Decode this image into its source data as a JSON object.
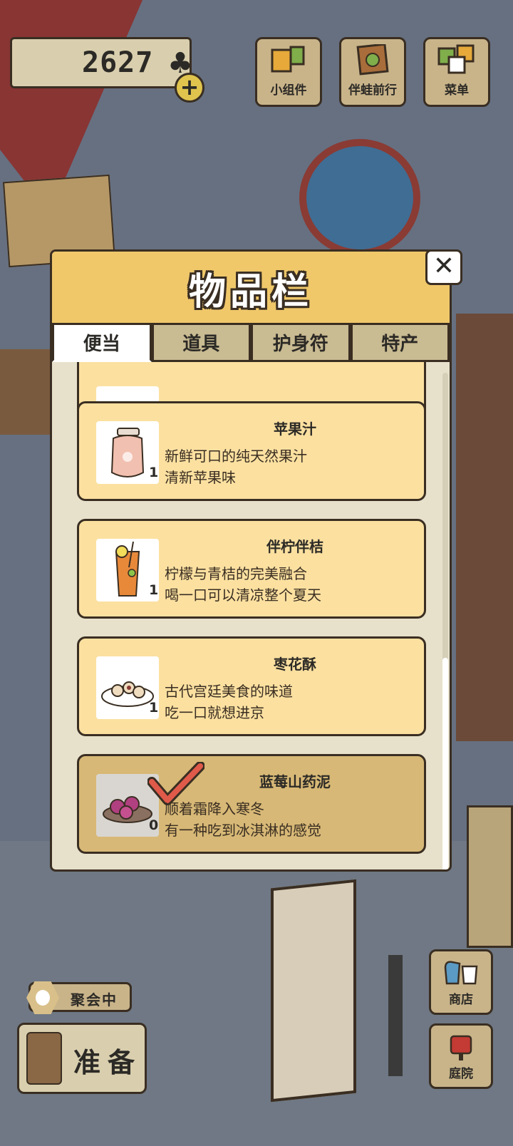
{
  "hud": {
    "clover_count": "2627",
    "clover_symbol": "♣",
    "add_symbol": "+",
    "buttons": [
      {
        "label": "小组件",
        "icon": "widget-icon"
      },
      {
        "label": "伴蛙前行",
        "icon": "frog-journey-icon"
      },
      {
        "label": "菜单",
        "icon": "menu-cards-icon"
      }
    ]
  },
  "inventory": {
    "title": "物品栏",
    "close_symbol": "✕",
    "tabs": [
      "便当",
      "道具",
      "护身符",
      "特产"
    ],
    "active_tab": "便当",
    "items": [
      {
        "name": "苹果汁",
        "desc1": "新鲜可口的纯天然果汁",
        "desc2": "清新苹果味",
        "qty": "1",
        "icon": "apple-juice-jar-icon",
        "selected": false
      },
      {
        "name": "伴柠伴桔",
        "desc1": "柠檬与青桔的完美融合",
        "desc2": "喝一口可以清凉整个夏天",
        "qty": "1",
        "icon": "lemon-drink-icon",
        "selected": false
      },
      {
        "name": "枣花酥",
        "desc1": "古代宫廷美食的味道",
        "desc2": "吃一口就想进京",
        "qty": "1",
        "icon": "date-pastry-icon",
        "selected": false
      },
      {
        "name": "蓝莓山药泥",
        "desc1": "顺着霜降入寒冬",
        "desc2": "有一种吃到冰淇淋的感觉",
        "qty": "0",
        "icon": "blueberry-yam-icon",
        "selected": true
      }
    ]
  },
  "bottom": {
    "party_label": "聚会中",
    "ready_label": "准备",
    "side_buttons": [
      {
        "label": "商店",
        "icon": "shop-bags-icon"
      },
      {
        "label": "庭院",
        "icon": "mailbox-icon"
      }
    ]
  },
  "colors": {
    "panel_header": "#f0c86a",
    "item_card": "#fbe0a0",
    "item_selected": "#d7b876",
    "check_mark": "#e05a4a",
    "outline": "#3a2e22"
  }
}
